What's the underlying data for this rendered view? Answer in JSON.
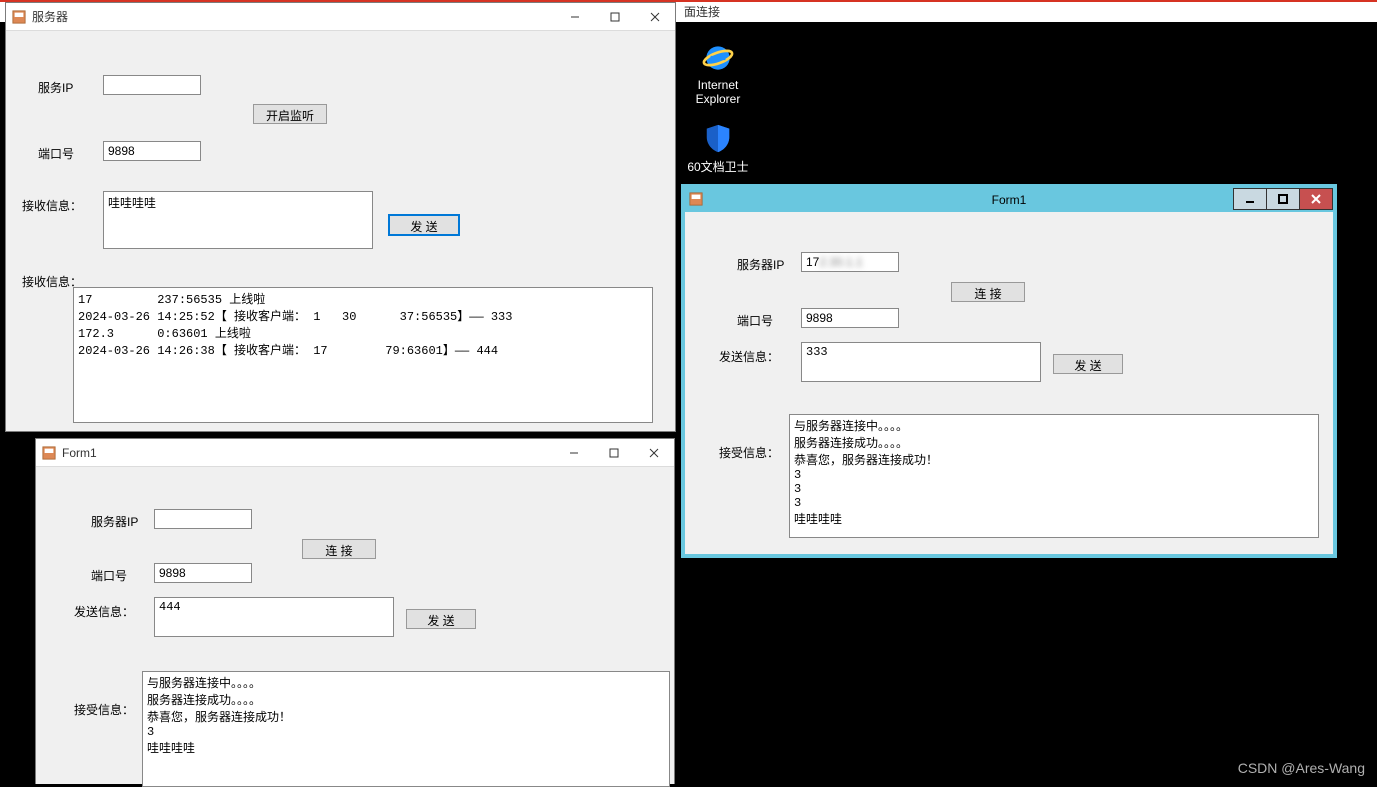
{
  "conn_bar_text": "面连接",
  "desktop": {
    "ie": {
      "label": "Internet\nExplorer",
      "icon": "ie-icon"
    },
    "shield": {
      "label": "60文档卫士",
      "icon": "shield-icon"
    }
  },
  "server_win": {
    "title": "服务器",
    "labels": {
      "server_ip": "服务IP",
      "port": "端口号",
      "input_msg": "接收信息：",
      "log": "接收信息："
    },
    "server_ip_value": "",
    "port_value": "9898",
    "input_value": "哇哇哇哇",
    "btn_listen": "开启监听",
    "btn_send": "发   送",
    "log_text": "17         237:56535 上线啦\n2024-03-26 14:25:52【 接收客户端： 1   30      37:56535】—— 333\n172.3      0:63601 上线啦\n2024-03-26 14:26:38【 接收客户端： 17        79:63601】—— 444"
  },
  "form1_local": {
    "title": "Form1",
    "labels": {
      "server_ip": "服务器IP",
      "port": "端口号",
      "send": "发送信息：",
      "recv": "接受信息："
    },
    "server_ip_value": "",
    "port_value": "9898",
    "send_value": "444",
    "btn_connect": "连   接",
    "btn_send": "发   送",
    "recv_text": "与服务器连接中。。。。\n服务器连接成功。。。。\n恭喜您，服务器连接成功！\n3\n哇哇哇哇"
  },
  "form1_remote": {
    "title": "Form1",
    "labels": {
      "server_ip": "服务器IP",
      "port": "端口号",
      "send": "发送信息：",
      "recv": "接受信息："
    },
    "server_ip_value": "17",
    "port_value": "9898",
    "send_value": "333",
    "btn_connect": "连   接",
    "btn_send": "发   送",
    "recv_text": "与服务器连接中。。。。\n服务器连接成功。。。。\n恭喜您，服务器连接成功！\n3\n3\n3\n哇哇哇哇"
  },
  "watermark": "CSDN @Ares-Wang"
}
